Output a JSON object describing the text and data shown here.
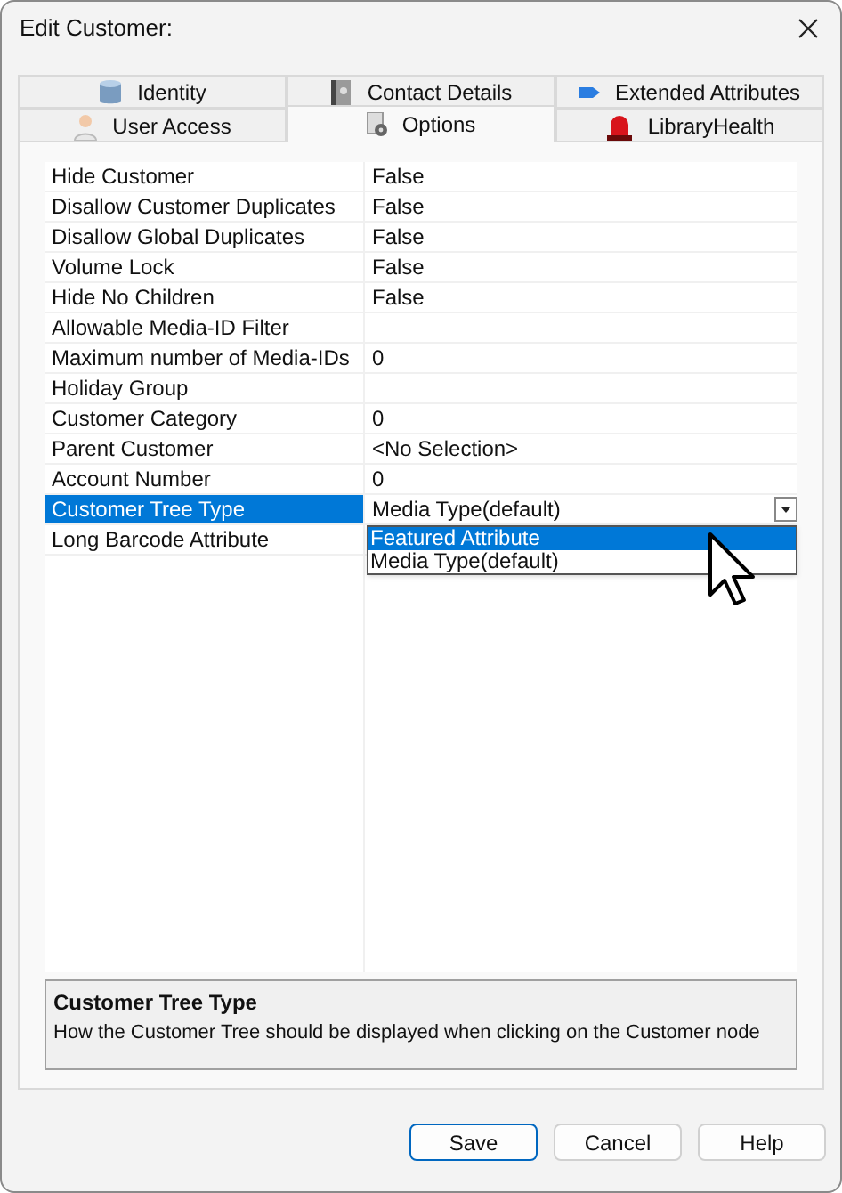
{
  "window": {
    "title": "Edit Customer:"
  },
  "tab_rows": [
    [
      {
        "label": "Identity",
        "selected": false
      },
      {
        "label": "Contact Details",
        "selected": false
      },
      {
        "label": "Extended Attributes",
        "selected": false
      }
    ],
    [
      {
        "label": "User Access",
        "selected": false
      },
      {
        "label": "Options",
        "selected": true
      },
      {
        "label": "LibraryHealth",
        "selected": false
      }
    ]
  ],
  "properties": [
    {
      "name": "Hide Customer",
      "value": "False",
      "kind": "text",
      "selected": false
    },
    {
      "name": "Disallow Customer Duplicates",
      "value": "False",
      "kind": "text",
      "selected": false
    },
    {
      "name": "Disallow Global Duplicates",
      "value": "False",
      "kind": "text",
      "selected": false
    },
    {
      "name": "Volume Lock",
      "value": "False",
      "kind": "text",
      "selected": false
    },
    {
      "name": "Hide No Children",
      "value": "False",
      "kind": "text",
      "selected": false
    },
    {
      "name": "Allowable Media-ID Filter",
      "kind": "text",
      "selected": false
    },
    {
      "name": "Maximum number of Media-IDs",
      "value": "0",
      "kind": "text",
      "selected": false
    },
    {
      "name": "Holiday Group",
      "kind": "text",
      "selected": false
    },
    {
      "name": "Customer Category",
      "value": "0",
      "kind": "text",
      "selected": false
    },
    {
      "name": "Parent Customer",
      "value": "<No Selection>",
      "kind": "text",
      "selected": false
    },
    {
      "name": "Account Number",
      "value": "0",
      "kind": "text",
      "selected": false
    },
    {
      "name": "Customer Tree Type",
      "value": "Media Type(default)",
      "kind": "dropdown",
      "selected": true,
      "options": [
        {
          "label": "Featured Attribute",
          "highlighted": true
        },
        {
          "label": "Media Type(default)",
          "highlighted": false
        }
      ]
    },
    {
      "name": "Long Barcode Attribute",
      "kind": "text",
      "selected": false
    }
  ],
  "description": {
    "title": "Customer Tree Type",
    "text": "How the Customer Tree should be displayed when clicking on the Customer node"
  },
  "buttons": [
    {
      "label": "Save",
      "default": true
    },
    {
      "label": "Cancel",
      "default": false
    },
    {
      "label": "Help",
      "default": false
    }
  ]
}
